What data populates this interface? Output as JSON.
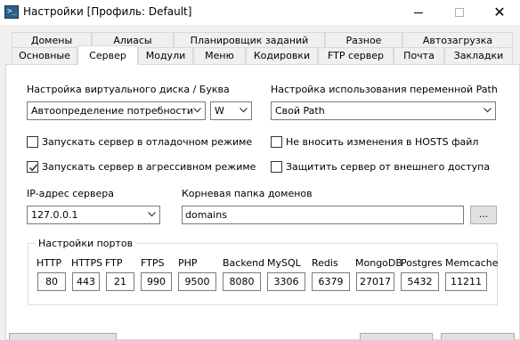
{
  "window": {
    "title": "Настройки [Профиль: Default]",
    "icon": "terminal-icon",
    "controls": {
      "minimize": "minimize-icon",
      "maximize": "maximize-icon",
      "close": "✕"
    }
  },
  "tabs": {
    "row1": [
      "Домены",
      "Алиасы",
      "Планировщик заданий",
      "Разное",
      "Автозагрузка"
    ],
    "row2": [
      "Основные",
      "Сервер",
      "Модули",
      "Меню",
      "Кодировки",
      "FTP сервер",
      "Почта",
      "Закладки"
    ],
    "active": "Сервер"
  },
  "server": {
    "virtual_disk": {
      "label": "Настройка виртуального диска / Буква",
      "mode_value": "Автоопределение потребности",
      "letter_value": "W"
    },
    "path_var": {
      "label": "Настройка использования переменной Path",
      "value": "Свой Path"
    },
    "checkboxes": {
      "debug_mode": {
        "label": "Запускать сервер в отладочном режиме",
        "checked": false
      },
      "aggressive_mode": {
        "label": "Запускать сервер в агрессивном режиме",
        "checked": true
      },
      "no_hosts": {
        "label": "Не вносить изменения в HOSTS файл",
        "checked": false
      },
      "protect_external": {
        "label": "Защитить сервер от внешнего доступа",
        "checked": false
      }
    },
    "ip": {
      "label": "IP-адрес сервера",
      "value": "127.0.0.1"
    },
    "domains_root": {
      "label": "Корневая папка доменов",
      "value": "domains",
      "browse_label": "..."
    },
    "ports": {
      "title": "Настройки портов",
      "items": [
        {
          "name": "HTTP",
          "value": "80"
        },
        {
          "name": "HTTPS",
          "value": "443"
        },
        {
          "name": "FTP",
          "value": "21"
        },
        {
          "name": "FTPS",
          "value": "990"
        },
        {
          "name": "PHP",
          "value": "9500"
        },
        {
          "name": "Backend",
          "value": "8080"
        },
        {
          "name": "MySQL",
          "value": "3306"
        },
        {
          "name": "Redis",
          "value": "6379"
        },
        {
          "name": "MongoDB",
          "value": "27017"
        },
        {
          "name": "Postgres",
          "value": "5432"
        },
        {
          "name": "Memcache",
          "value": "11211"
        }
      ]
    }
  },
  "colors": {
    "panel_bg": "#ffffff",
    "window_bg": "#f0f0f0",
    "border": "#7a7a7a",
    "icon_bg": "#2b5f8a"
  }
}
